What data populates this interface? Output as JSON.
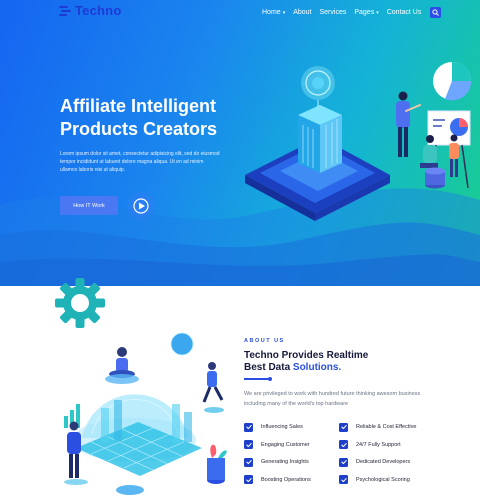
{
  "brand": {
    "name": "Techno"
  },
  "nav": {
    "items": [
      {
        "label": "Home",
        "has_dropdown": true
      },
      {
        "label": "About",
        "has_dropdown": false
      },
      {
        "label": "Services",
        "has_dropdown": false
      },
      {
        "label": "Pages",
        "has_dropdown": true
      },
      {
        "label": "Contact Us",
        "has_dropdown": false
      }
    ],
    "search_icon": "search-icon"
  },
  "hero": {
    "title_line1": "Affiliate Intelligent",
    "title_line2": "Products Creators",
    "description": "Lorem ipsum dolor sit amet, consectetur adipisicing elit, sed do eiusmod tempor incididunt ut laburet dolore magna aliqua. Ut en ad minim ullamco laboris nisi ut aliquip.",
    "cta_label": "How IT Work",
    "play_icon": "play-icon"
  },
  "about": {
    "tag": "ABOUT US",
    "title_line1": "Techno Provides Realtime",
    "title_line2_prefix": "Best Data ",
    "title_line2_highlight": "Solutions.",
    "description": "We are privileged to work with hundred future thinking awesom business including many of the world's top hardware",
    "features": [
      "Influencing Sales",
      "Reliable & Cost Effective",
      "Engaging Customer",
      "24/7 Fully Support",
      "Generating Insights",
      "Dedicated Developers",
      "Boosting Operations",
      "Psychological Scoring"
    ]
  },
  "colors": {
    "brand_blue": "#1e3ad6",
    "accent_blue": "#2b4fe0",
    "check_blue": "#1e40c8",
    "gear_teal": "#1fb3b8",
    "hero_gradient_start": "#1565f0",
    "hero_gradient_end": "#19d08a"
  }
}
